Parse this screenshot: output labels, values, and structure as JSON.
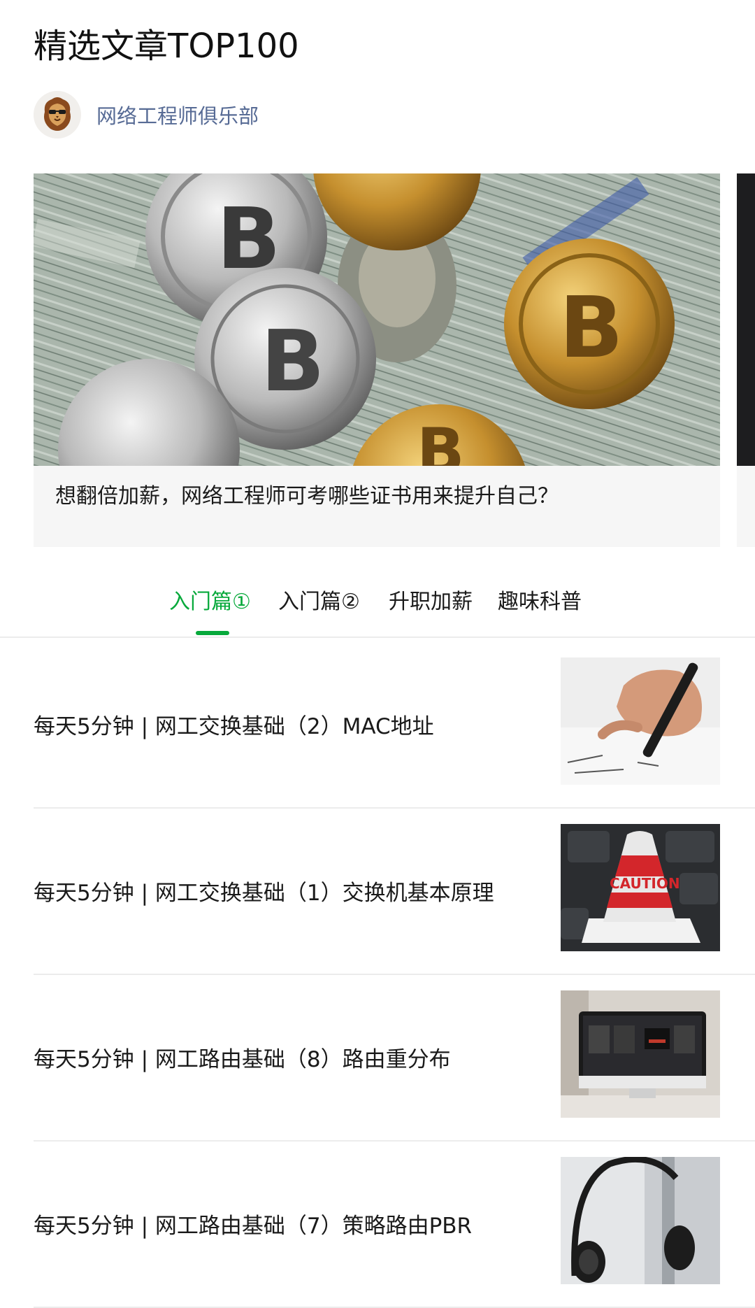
{
  "page": {
    "title": "精选文章TOP100"
  },
  "account": {
    "name": "网络工程师俱乐部",
    "avatar_icon": "lion-with-sunglasses-avatar"
  },
  "featured": {
    "caption": "想翻倍加薪，网络工程师可考哪些证书用来提升自己？",
    "image": "bitcoin-coins-on-dollar-bills-photo"
  },
  "tabs": [
    {
      "label": "入门篇①",
      "active": true
    },
    {
      "label": "入门篇②",
      "active": false
    },
    {
      "label": "升职加薪",
      "active": false
    },
    {
      "label": "趣味科普",
      "active": false
    }
  ],
  "articles": [
    {
      "title": "每天5分钟 | 网工交换基础（2）MAC地址",
      "thumbnail": "hand-writing-with-pen-photo"
    },
    {
      "title": "每天5分钟 | 网工交换基础（1）交换机基本原理",
      "thumbnail": "caution-cone-on-keyboard-photo"
    },
    {
      "title": "每天5分钟 | 网工路由基础（8）路由重分布",
      "thumbnail": "monitor-on-desk-photo"
    },
    {
      "title": "每天5分钟 | 网工路由基础（7）策略路由PBR",
      "thumbnail": "headphones-on-stand-photo"
    }
  ],
  "colors": {
    "accent": "#07a93b",
    "link": "#576b95",
    "divider": "#ececec",
    "caption_bg": "#f6f6f6"
  }
}
